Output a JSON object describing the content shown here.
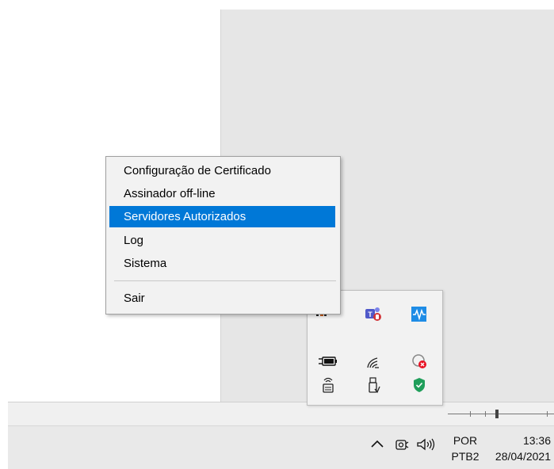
{
  "context_menu": {
    "items": [
      {
        "label": "Configuração de Certificado",
        "highlighted": false
      },
      {
        "label": "Assinador off-line",
        "highlighted": false
      },
      {
        "label": "Servidores Autorizados",
        "highlighted": true
      },
      {
        "label": "Log",
        "highlighted": false
      },
      {
        "label": "Sistema",
        "highlighted": false
      },
      {
        "label": "Sair",
        "highlighted": false
      }
    ],
    "highlight_color": "#0078d7"
  },
  "tray_overflow": {
    "icons": [
      {
        "name": "partial-app-icon"
      },
      {
        "name": "teams-icon"
      },
      {
        "name": "waveform-app-icon"
      },
      {
        "name": "battery-plug-icon"
      },
      {
        "name": "wireless-signal-icon"
      },
      {
        "name": "disconnected-icon"
      },
      {
        "name": "router-icon"
      },
      {
        "name": "usb-eject-icon"
      },
      {
        "name": "shield-check-icon"
      }
    ]
  },
  "taskbar": {
    "language_line1": "POR",
    "language_line2": "PTB2",
    "time": "13:36",
    "date": "28/04/2021"
  }
}
